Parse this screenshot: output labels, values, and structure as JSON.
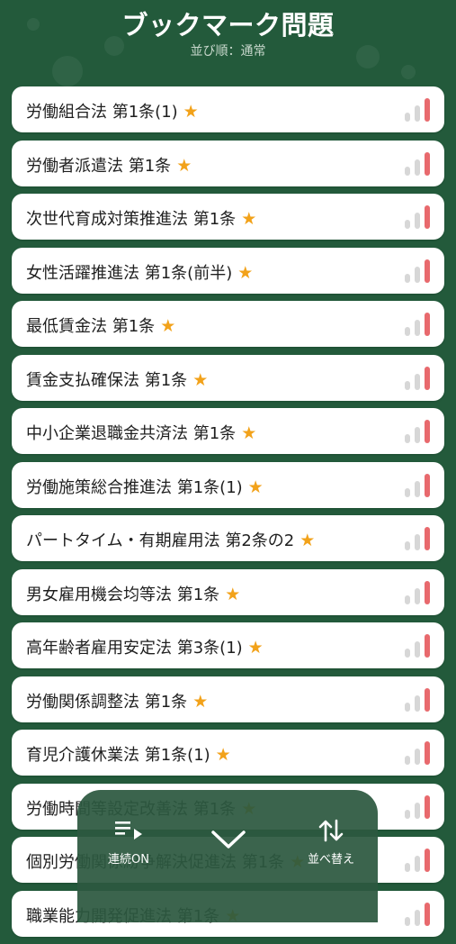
{
  "header": {
    "title": "ブックマーク問題",
    "sort_label": "並び順：通常"
  },
  "items": [
    {
      "label": "労働組合法 第1条(1)",
      "starred": true
    },
    {
      "label": "労働者派遣法 第1条",
      "starred": true
    },
    {
      "label": "次世代育成対策推進法 第1条",
      "starred": true
    },
    {
      "label": "女性活躍推進法 第1条(前半)",
      "starred": true
    },
    {
      "label": "最低賃金法 第1条",
      "starred": true
    },
    {
      "label": "賃金支払確保法 第1条",
      "starred": true
    },
    {
      "label": "中小企業退職金共済法 第1条",
      "starred": true
    },
    {
      "label": "労働施策総合推進法 第1条(1)",
      "starred": true
    },
    {
      "label": "パートタイム・有期雇用法 第2条の2",
      "starred": true
    },
    {
      "label": "男女雇用機会均等法 第1条",
      "starred": true
    },
    {
      "label": "高年齢者雇用安定法 第3条(1)",
      "starred": true
    },
    {
      "label": "労働関係調整法 第1条",
      "starred": true
    },
    {
      "label": "育児介護休業法 第1条(1)",
      "starred": true
    },
    {
      "label": "労働時間等設定改善法 第1条",
      "starred": true
    },
    {
      "label": "個別労働関係紛争解決促進法 第1条",
      "starred": true
    },
    {
      "label": "職業能力開発促進法 第1条",
      "starred": true
    }
  ],
  "star_glyph": "★",
  "colors": {
    "background": "#235a3b",
    "star": "#f2a21a",
    "bar_active": "#e8696d",
    "bar_inactive": "#d7d7d7"
  },
  "toolbar": {
    "continuous_label": "連続ON",
    "sort_label": "並べ替え",
    "icons": [
      "playlist-play-icon",
      "chevron-down-icon",
      "swap-vertical-icon"
    ]
  }
}
